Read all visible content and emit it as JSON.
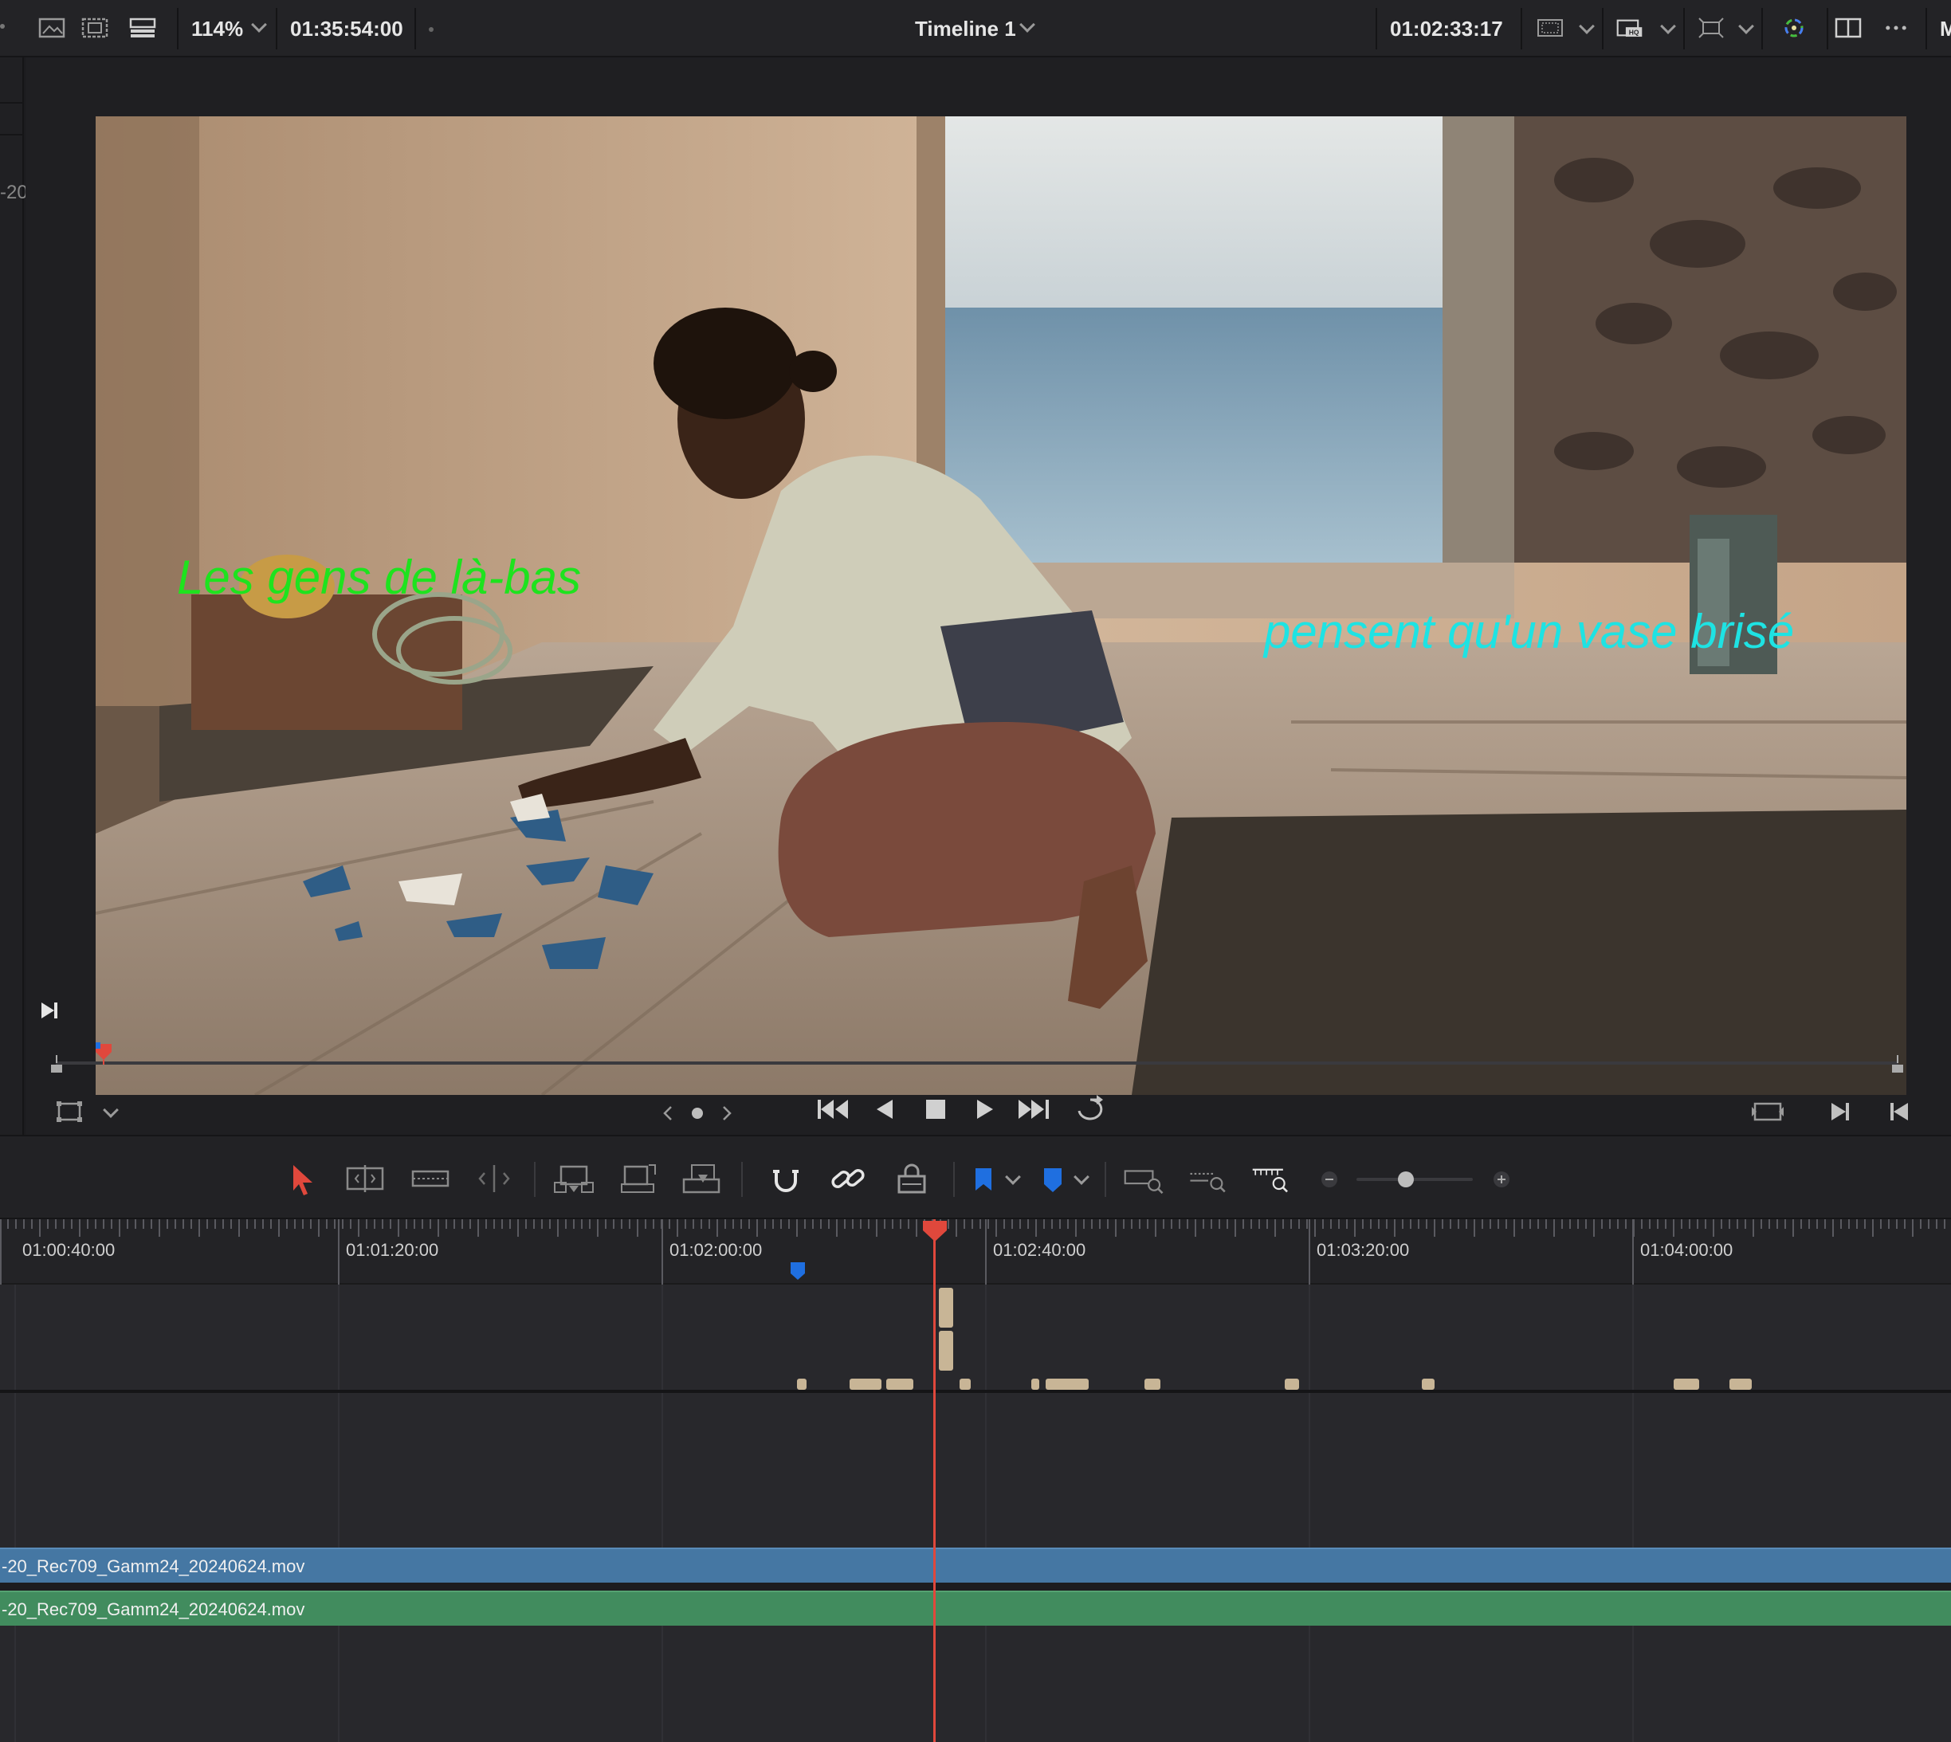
{
  "topbar": {
    "zoom": "114%",
    "source_timecode": "01:35:54:00",
    "timeline_name": "Timeline 1",
    "record_timecode": "01:02:33:17",
    "right_edge_label": "M"
  },
  "left_panel": {
    "fragment": "-20"
  },
  "viewer": {
    "subtitle_left": "Les gens de là-bas",
    "subtitle_right": "pensent qu'un vase brisé",
    "colors": {
      "subtitle_left": "#1ee31e",
      "subtitle_right": "#1ee3e3"
    }
  },
  "timeline": {
    "ruler_labels": [
      "01:00:40:00",
      "01:01:20:00",
      "01:02:00:00",
      "01:02:40:00",
      "01:03:20:00",
      "01:04:00:00"
    ],
    "video_clip": "-20_Rec709_Gamm24_20240624.mov",
    "audio_clip": "-20_Rec709_Gamm24_20240624.mov",
    "colors": {
      "video_clip": "#4577a3",
      "audio_clip": "#418c5e",
      "playhead": "#e0483c",
      "marker": "#1f6fe0",
      "subtitle_block": "#c8b596"
    }
  },
  "icons": {
    "toolbar": [
      "selection-arrow-icon",
      "trim-edit-icon",
      "dynamic-trim-icon",
      "blade-icon",
      "insert-clip-icon",
      "overwrite-clip-icon",
      "replace-clip-icon",
      "snapping-icon",
      "linked-selection-icon",
      "position-lock-icon",
      "flag-icon",
      "marker-icon",
      "full-extent-zoom-icon",
      "detail-zoom-icon",
      "custom-zoom-icon",
      "zoom-out-icon",
      "zoom-in-icon"
    ],
    "transport": [
      "jump-to-start-icon",
      "play-reverse-icon",
      "stop-icon",
      "play-icon",
      "jump-to-end-icon",
      "loop-icon"
    ]
  }
}
